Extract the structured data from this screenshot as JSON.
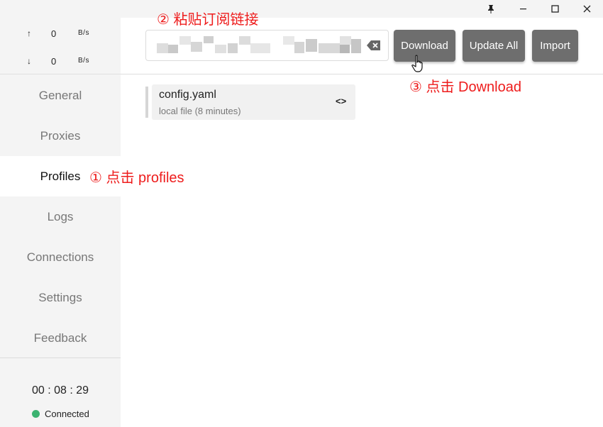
{
  "window": {
    "pin_icon": "pin-icon",
    "minimize_icon": "minimize-icon",
    "maximize_icon": "maximize-icon",
    "close_icon": "close-icon"
  },
  "traffic": {
    "up": {
      "arrow": "↑",
      "value": "0",
      "unit": "B/s"
    },
    "down": {
      "arrow": "↓",
      "value": "0",
      "unit": "B/s"
    }
  },
  "nav": {
    "items": [
      {
        "label": "General",
        "active": false
      },
      {
        "label": "Proxies",
        "active": false
      },
      {
        "label": "Profiles",
        "active": true
      },
      {
        "label": "Logs",
        "active": false
      },
      {
        "label": "Connections",
        "active": false
      },
      {
        "label": "Settings",
        "active": false
      },
      {
        "label": "Feedback",
        "active": false
      }
    ]
  },
  "status": {
    "timer": "00 : 08 : 29",
    "connection": "Connected",
    "connection_color": "#3cb371"
  },
  "profiles": {
    "url_input_value": "",
    "buttons": {
      "download": "Download",
      "update_all": "Update All",
      "import": "Import"
    },
    "list": [
      {
        "name": "config.yaml",
        "subtitle": "local file (8 minutes)",
        "action": "<>"
      }
    ]
  },
  "annotations": {
    "step1": "① 点击 profiles",
    "step2": "② 粘贴订阅链接",
    "step3": "③ 点击 Download",
    "color": "#ee1c1c"
  }
}
